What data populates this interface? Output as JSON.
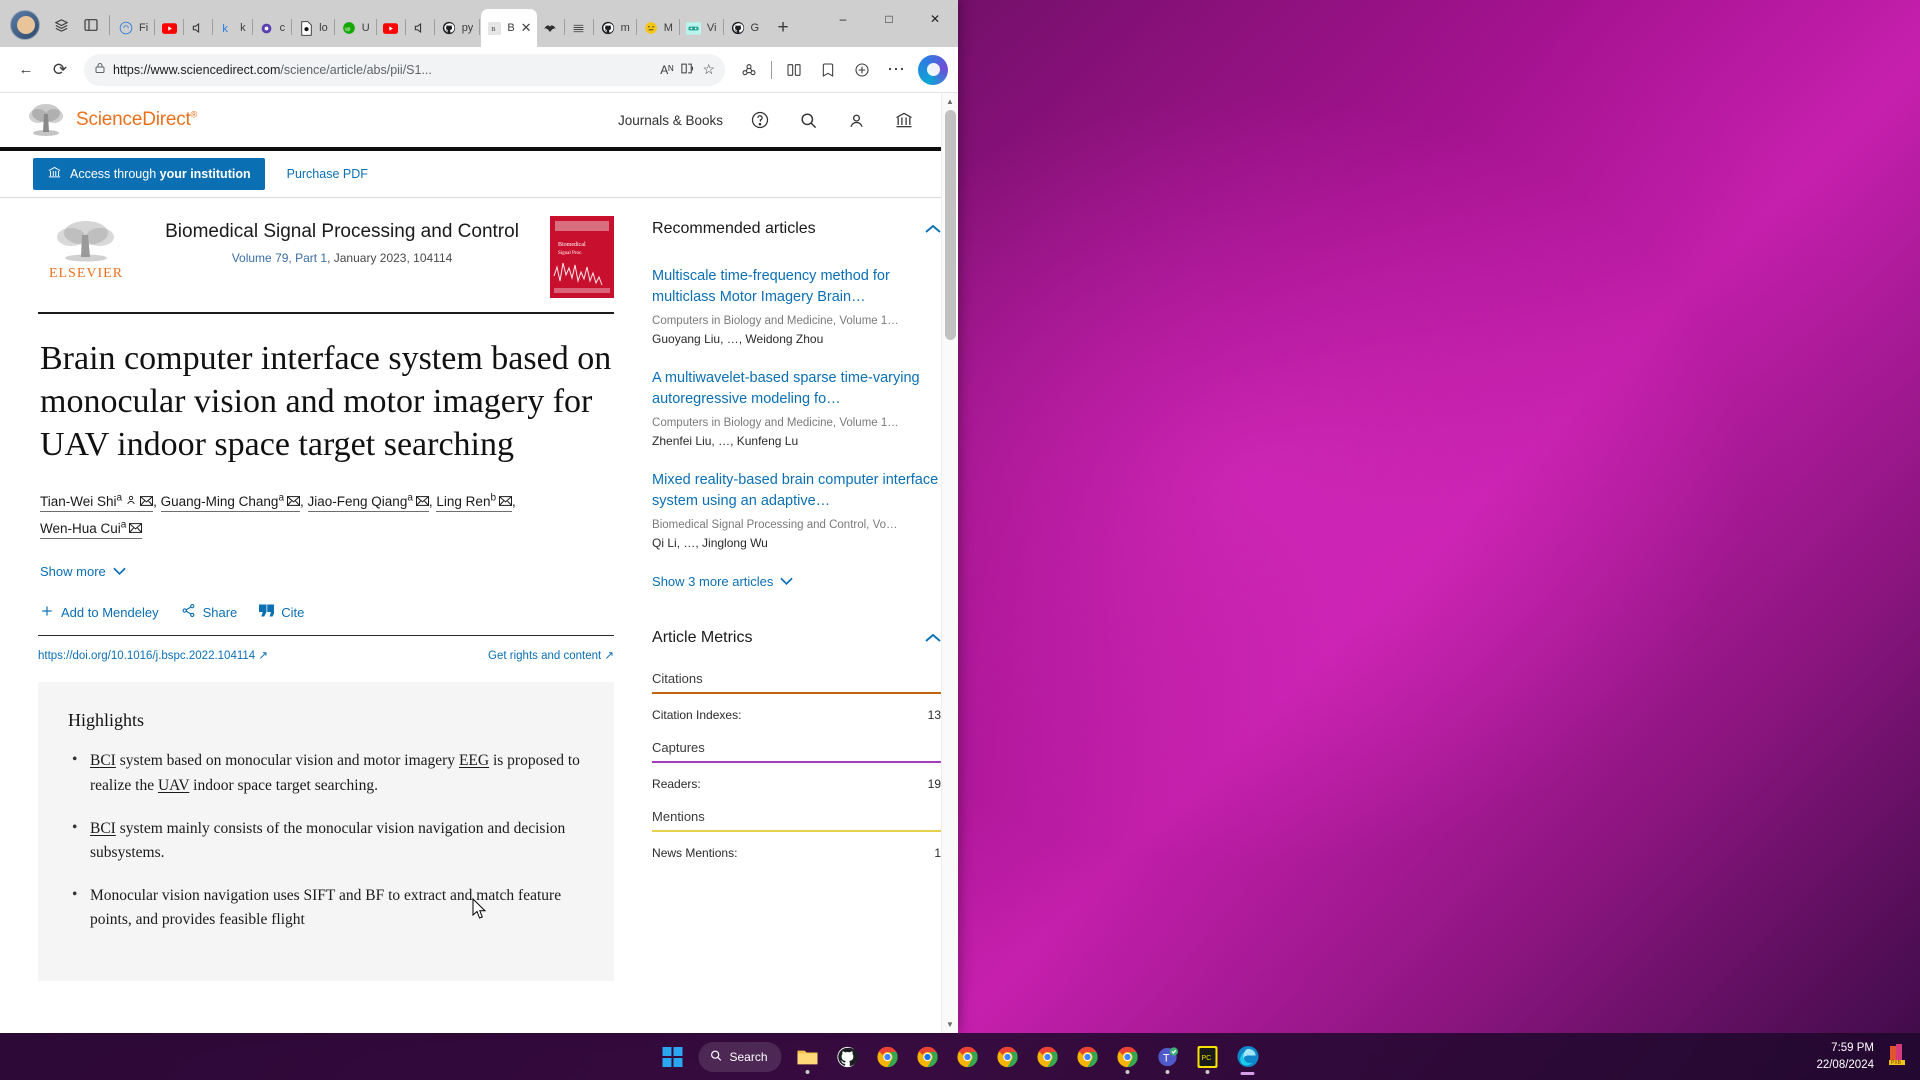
{
  "browser": {
    "tabs": [
      {
        "label": "Fi",
        "icon": "firefox-icon",
        "active": false
      },
      {
        "label": "",
        "icon": "youtube-icon",
        "active": false
      },
      {
        "label": "",
        "icon": "speaker-icon",
        "active": false
      },
      {
        "label": "k",
        "icon": "k-icon",
        "active": false
      },
      {
        "label": "c",
        "icon": "circle-icon",
        "active": false
      },
      {
        "label": "lo",
        "icon": "doc-icon",
        "active": false
      },
      {
        "label": "U",
        "icon": "upwork-icon",
        "active": false
      },
      {
        "label": "",
        "icon": "youtube-icon",
        "active": false
      },
      {
        "label": "",
        "icon": "speaker-icon",
        "active": false
      },
      {
        "label": "py",
        "icon": "github-icon",
        "active": false
      },
      {
        "label": "B",
        "icon": "sciencedirect-icon",
        "active": true
      },
      {
        "label": "",
        "icon": "bird-icon",
        "active": false
      },
      {
        "label": "",
        "icon": "lines-icon",
        "active": false
      },
      {
        "label": "m",
        "icon": "github-icon",
        "active": false
      },
      {
        "label": "M",
        "icon": "emoji-icon",
        "active": false
      },
      {
        "label": "Vi",
        "icon": "vscode-icon",
        "active": false
      },
      {
        "label": "G",
        "icon": "github-icon",
        "active": false
      }
    ],
    "new_tab_label": "+",
    "window_controls": {
      "minimize": "–",
      "maximize": "□",
      "close": "✕"
    },
    "nav": {
      "back": "←",
      "forward": "→",
      "reload": "⟳",
      "lock_icon": "lock-icon",
      "url_host": "https://www.sciencedirect.com",
      "url_path": "/science/article/abs/pii/S1...",
      "read_aloud": "Aᴺ",
      "immersive_reader": "immersive-reader-icon",
      "favorite": "☆",
      "split_screen": "split-screen-icon",
      "collections": "collections-icon",
      "browser_essentials": "browser-essentials-icon",
      "favorites_bar": "favorites-icon",
      "settings": "⋯",
      "copilot": "copilot-icon"
    }
  },
  "sciencedirect": {
    "brand": "ScienceDirect",
    "brand_sup": "®",
    "nav_label": "Journals & Books",
    "nav_icons": [
      "help-icon",
      "search-icon",
      "account-icon",
      "institution-icon"
    ],
    "access_button": {
      "prefix": "Access through ",
      "bold": "your institution",
      "icon": "institution-icon"
    },
    "purchase_button": "Purchase PDF"
  },
  "journal": {
    "publisher": "ELSEVIER",
    "name": "Biomedical Signal Processing and Control",
    "volume": "Volume 79, Part 1",
    "issue_date": ", January 2023, 104114"
  },
  "article": {
    "title": "Brain computer interface system based on monocular vision and motor imagery for UAV indoor space target searching",
    "authors": [
      {
        "name": "Tian-Wei Shi",
        "affiliation": "a",
        "icons": [
          "author-profile-icon",
          "envelope-icon"
        ],
        "trailing": ","
      },
      {
        "name": "Guang-Ming Chang",
        "affiliation": "a",
        "icons": [
          "envelope-icon"
        ],
        "trailing": ","
      },
      {
        "name": "Jiao-Feng Qiang",
        "affiliation": "a",
        "icons": [
          "envelope-icon"
        ],
        "trailing": ","
      },
      {
        "name": "Ling Ren",
        "affiliation": "b",
        "icons": [
          "envelope-icon"
        ],
        "trailing": ","
      },
      {
        "name": "Wen-Hua Cui",
        "affiliation": "a",
        "icons": [
          "envelope-icon"
        ],
        "trailing": ""
      }
    ],
    "show_more": "Show more",
    "actions": [
      {
        "label": "Add to Mendeley",
        "icon": "plus-icon"
      },
      {
        "label": "Share",
        "icon": "share-icon"
      },
      {
        "label": "Cite",
        "icon": "quote-icon"
      }
    ],
    "doi": "https://doi.org/10.1016/j.bspc.2022.104114",
    "doi_external_icon": "↗",
    "rights": "Get rights and content",
    "rights_external_icon": "↗"
  },
  "highlights": {
    "heading": "Highlights",
    "items": [
      {
        "parts": [
          {
            "t": "BCI",
            "u": true
          },
          {
            "t": " system based on monocular vision and motor imagery ",
            "u": false
          },
          {
            "t": "EEG",
            "u": true
          },
          {
            "t": " is proposed to realize the ",
            "u": false
          },
          {
            "t": "UAV",
            "u": true
          },
          {
            "t": " indoor space target searching.",
            "u": false
          }
        ]
      },
      {
        "parts": [
          {
            "t": "BCI",
            "u": true
          },
          {
            "t": " system mainly consists of the monocular vision navigation and decision subsystems.",
            "u": false
          }
        ]
      },
      {
        "parts": [
          {
            "t": "Monocular vision navigation uses SIFT and BF to extract and match feature points, and provides feasible flight",
            "u": false
          }
        ]
      }
    ]
  },
  "sidebar": {
    "recommended": {
      "title": "Recommended articles",
      "collapse_icon": "chevron-up-icon",
      "items": [
        {
          "title": "Multiscale time-frequency method for multiclass Motor Imagery Brain…",
          "source": "Computers in Biology and Medicine, Volume 1…",
          "authors": "Guoyang Liu, …, Weidong Zhou"
        },
        {
          "title": "A multiwavelet-based sparse time-varying autoregressive modeling fo…",
          "source": "Computers in Biology and Medicine, Volume 1…",
          "authors": "Zhenfei Liu, …, Kunfeng Lu"
        },
        {
          "title": "Mixed reality-based brain computer interface system using an adaptive…",
          "source": "Biomedical Signal Processing and Control, Vo…",
          "authors": "Qi Li, …, Jinglong Wu"
        }
      ],
      "show_more": "Show 3 more articles"
    },
    "metrics": {
      "title": "Article Metrics",
      "collapse_icon": "chevron-up-icon",
      "groups": [
        {
          "label": "Citations",
          "color": "#c0640f",
          "rows": [
            {
              "label": "Citation Indexes:",
              "value": "13"
            }
          ]
        },
        {
          "label": "Captures",
          "color": "#a73cc4",
          "rows": [
            {
              "label": "Readers:",
              "value": "19"
            }
          ]
        },
        {
          "label": "Mentions",
          "color": "#e8d14a",
          "rows": [
            {
              "label": "News Mentions:",
              "value": "1"
            }
          ]
        }
      ]
    }
  },
  "taskbar": {
    "start_icon": "windows-start-icon",
    "search_label": "Search",
    "search_icon": "search-icon",
    "apps": [
      {
        "name": "file-explorer-icon",
        "running": true
      },
      {
        "name": "github-desktop-icon",
        "running": false
      },
      {
        "name": "chrome-icon",
        "running": false
      },
      {
        "name": "edge-blue-icon",
        "running": false
      },
      {
        "name": "chrome-icon",
        "running": false
      },
      {
        "name": "chrome-icon",
        "running": false
      },
      {
        "name": "chrome-icon",
        "running": false
      },
      {
        "name": "chrome-icon",
        "running": false
      },
      {
        "name": "chrome-icon",
        "running": true
      },
      {
        "name": "teams-icon",
        "running": true
      },
      {
        "name": "pc-app-icon",
        "running": true
      },
      {
        "name": "edge-icon",
        "running": true,
        "active": true
      }
    ],
    "clock_time": "7:59 PM",
    "clock_date": "22/08/2024",
    "tray_icon": "tray-app-icon"
  }
}
